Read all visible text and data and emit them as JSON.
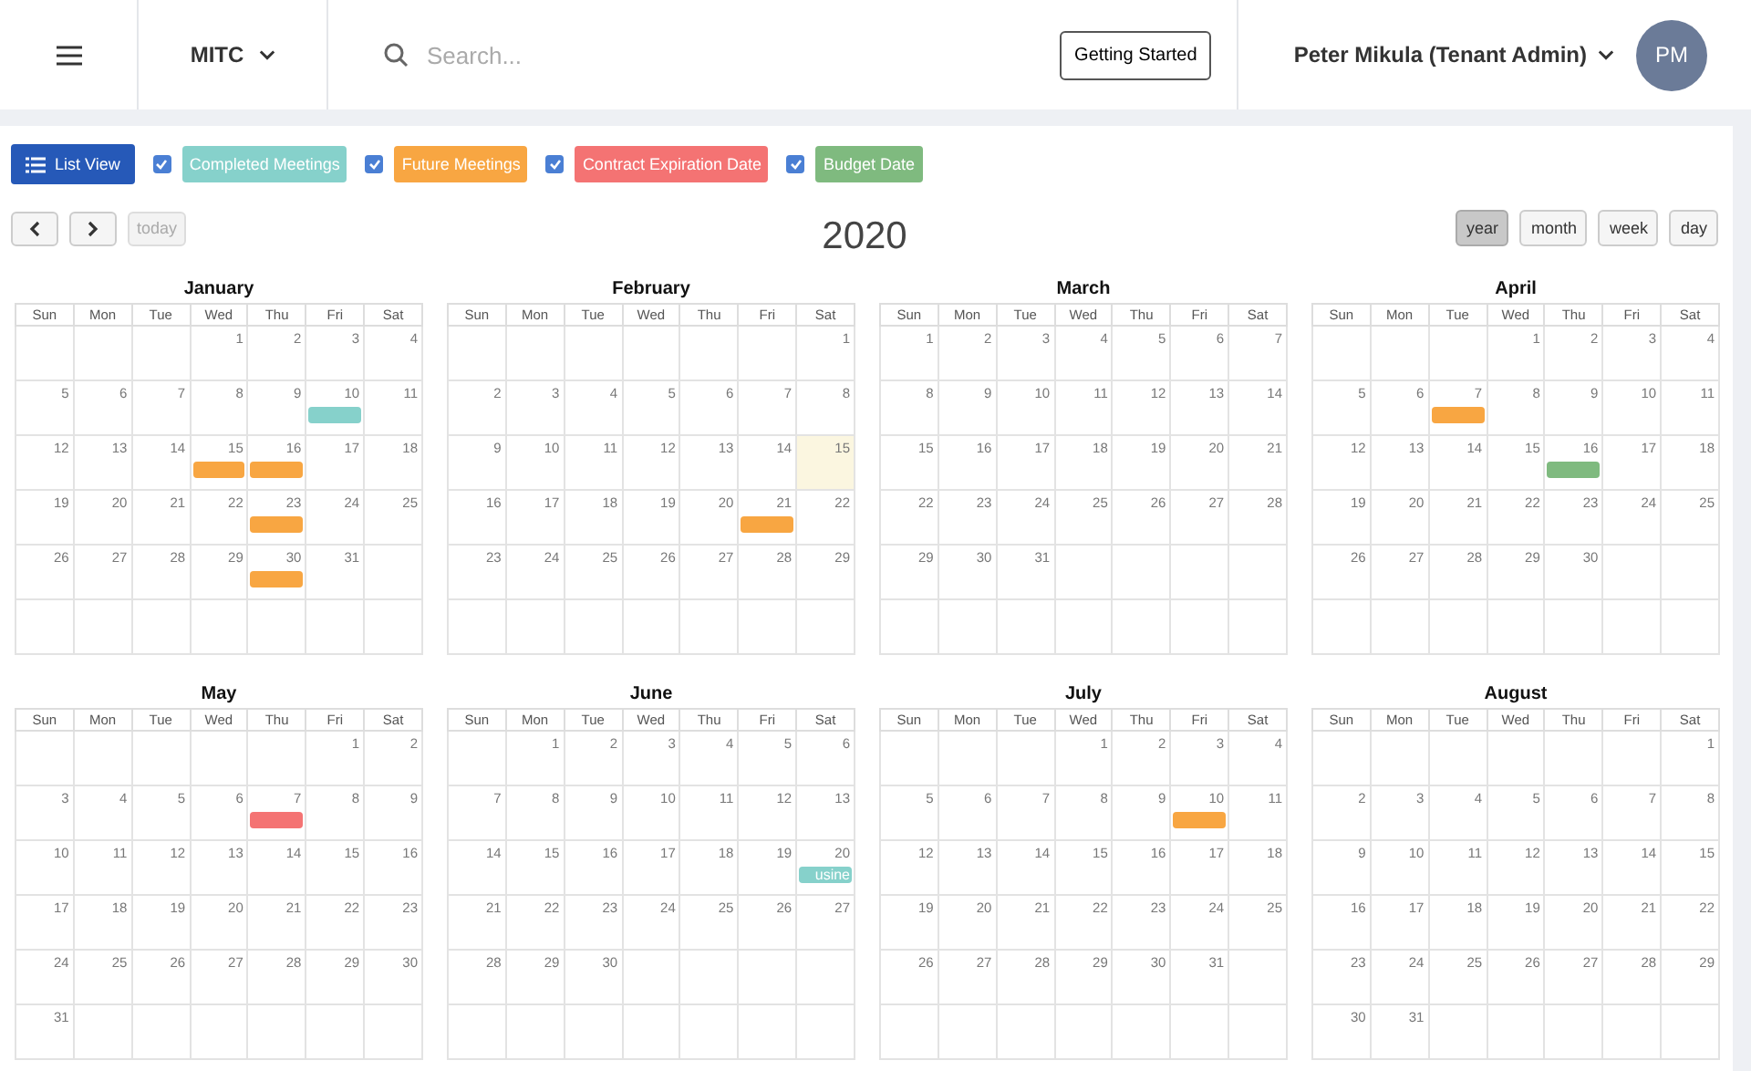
{
  "header": {
    "org": "MITC",
    "search": {
      "placeholder": "Search..."
    },
    "getting_started": "Getting Started",
    "user": "Peter Mikula (Tenant Admin)",
    "avatar": "PM"
  },
  "list_view": "List View",
  "legend": [
    {
      "label": "Completed Meetings",
      "checked": true,
      "color": "#86d1cb"
    },
    {
      "label": "Future Meetings",
      "checked": true,
      "color": "#f8a642"
    },
    {
      "label": "Contract Expiration Date",
      "checked": true,
      "color": "#f47373"
    },
    {
      "label": "Budget Date",
      "checked": true,
      "color": "#7fba7f"
    }
  ],
  "toolbar": {
    "today": {
      "label": "today",
      "disabled": true
    },
    "title": "2020",
    "views": [
      {
        "label": "year",
        "selected": true
      },
      {
        "label": "month",
        "selected": false
      },
      {
        "label": "week",
        "selected": false
      },
      {
        "label": "day",
        "selected": false
      }
    ]
  },
  "months": [
    {
      "name": "January",
      "weekdays": [
        "Sun",
        "Mon",
        "Tue",
        "Wed",
        "Thu",
        "Fri",
        "Sat"
      ],
      "weeks": [
        [
          "1",
          "2",
          "3",
          "4"
        ],
        [
          "5",
          "6",
          "7",
          "8",
          "9",
          {
            "day": "10",
            "event": {
              "color": "#86d1cb"
            }
          },
          "11"
        ],
        [
          "12",
          "13",
          "14",
          {
            "day": "15",
            "event": {
              "color": "#f8a642"
            }
          },
          {
            "day": "16",
            "event": {
              "color": "#f8a642"
            }
          },
          "17",
          "18"
        ],
        [
          "19",
          "20",
          "21",
          "22",
          {
            "day": "23",
            "event": {
              "color": "#f8a642"
            }
          },
          "24",
          "25"
        ],
        [
          "26",
          "27",
          "28",
          "29",
          {
            "day": "30",
            "event": {
              "color": "#f8a642"
            }
          },
          "31"
        ]
      ]
    },
    {
      "name": "February",
      "weekdays": [
        "Sun",
        "Mon",
        "Tue",
        "Wed",
        "Thu",
        "Fri",
        "Sat"
      ],
      "weeks": [
        [
          "1"
        ],
        [
          "2",
          "3",
          "4",
          "5",
          "6",
          "7",
          "8"
        ],
        [
          "9",
          "10",
          "11",
          "12",
          "13",
          "14",
          {
            "day": "15",
            "highlighted": true
          }
        ],
        [
          "16",
          "17",
          "18",
          "19",
          "20",
          {
            "day": "21",
            "event": {
              "color": "#f8a642"
            }
          },
          "22"
        ],
        [
          "23",
          "24",
          "25",
          "26",
          "27",
          "28",
          "29"
        ]
      ]
    },
    {
      "name": "March",
      "weekdays": [
        "Sun",
        "Mon",
        "Tue",
        "Wed",
        "Thu",
        "Fri",
        "Sat"
      ],
      "weeks": [
        [
          "1",
          "2",
          "3",
          "4",
          "5",
          "6",
          "7"
        ],
        [
          "8",
          "9",
          "10",
          "11",
          "12",
          "13",
          "14"
        ],
        [
          "15",
          "16",
          "17",
          "18",
          "19",
          "20",
          "21"
        ],
        [
          "22",
          "23",
          "24",
          "25",
          "26",
          "27",
          "28"
        ],
        [
          "29",
          "30",
          "31"
        ]
      ]
    },
    {
      "name": "April",
      "weekdays": [
        "Sun",
        "Mon",
        "Tue",
        "Wed",
        "Thu",
        "Fri",
        "Sat"
      ],
      "weeks": [
        [
          "1",
          "2",
          "3",
          "4"
        ],
        [
          "5",
          "6",
          {
            "day": "7",
            "event": {
              "color": "#f8a642"
            }
          },
          "8",
          "9",
          "10",
          "11"
        ],
        [
          "12",
          "13",
          "14",
          "15",
          {
            "day": "16",
            "event": {
              "color": "#7fba7f"
            }
          },
          "17",
          "18"
        ],
        [
          "19",
          "20",
          "21",
          "22",
          "23",
          "24",
          "25"
        ],
        [
          "26",
          "27",
          "28",
          "29",
          "30"
        ]
      ]
    },
    {
      "name": "May",
      "weekdays": [
        "Sun",
        "Mon",
        "Tue",
        "Wed",
        "Thu",
        "Fri",
        "Sat"
      ],
      "weeks": [
        [
          "1",
          "2"
        ],
        [
          "3",
          "4",
          "5",
          "6",
          {
            "day": "7",
            "event": {
              "color": "#f47373"
            }
          },
          "8",
          "9"
        ],
        [
          "10",
          "11",
          "12",
          "13",
          "14",
          "15",
          "16"
        ],
        [
          "17",
          "18",
          "19",
          "20",
          "21",
          "22",
          "23"
        ],
        [
          "24",
          "25",
          "26",
          "27",
          "28",
          "29",
          "30"
        ],
        [
          "31"
        ]
      ]
    },
    {
      "name": "June",
      "weekdays": [
        "Sun",
        "Mon",
        "Tue",
        "Wed",
        "Thu",
        "Fri",
        "Sat"
      ],
      "weeks": [
        [
          "1",
          "2",
          "3",
          "4",
          "5",
          "6"
        ],
        [
          "7",
          "8",
          "9",
          "10",
          "11",
          "12",
          "13"
        ],
        [
          "14",
          "15",
          "16",
          "17",
          "18",
          "19",
          {
            "day": "20",
            "event": {
              "color": "#86d1cb",
              "label": "usine"
            }
          }
        ],
        [
          "21",
          "22",
          "23",
          "24",
          "25",
          "26",
          "27"
        ],
        [
          "28",
          "29",
          "30"
        ]
      ]
    },
    {
      "name": "July",
      "weekdays": [
        "Sun",
        "Mon",
        "Tue",
        "Wed",
        "Thu",
        "Fri",
        "Sat"
      ],
      "weeks": [
        [
          "1",
          "2",
          "3",
          "4"
        ],
        [
          "5",
          "6",
          "7",
          "8",
          "9",
          {
            "day": "10",
            "event": {
              "color": "#f8a642"
            }
          },
          "11"
        ],
        [
          "12",
          "13",
          "14",
          "15",
          "16",
          "17",
          "18"
        ],
        [
          "19",
          "20",
          "21",
          "22",
          "23",
          "24",
          "25"
        ],
        [
          "26",
          "27",
          "28",
          "29",
          "30",
          "31"
        ]
      ]
    },
    {
      "name": "August",
      "weekdays": [
        "Sun",
        "Mon",
        "Tue",
        "Wed",
        "Thu",
        "Fri",
        "Sat"
      ],
      "weeks": [
        [
          "1"
        ],
        [
          "2",
          "3",
          "4",
          "5",
          "6",
          "7",
          "8"
        ],
        [
          "9",
          "10",
          "11",
          "12",
          "13",
          "14",
          "15"
        ],
        [
          "16",
          "17",
          "18",
          "19",
          "20",
          "21",
          "22"
        ],
        [
          "23",
          "24",
          "25",
          "26",
          "27",
          "28",
          "29"
        ],
        [
          "30",
          "31"
        ]
      ]
    }
  ]
}
